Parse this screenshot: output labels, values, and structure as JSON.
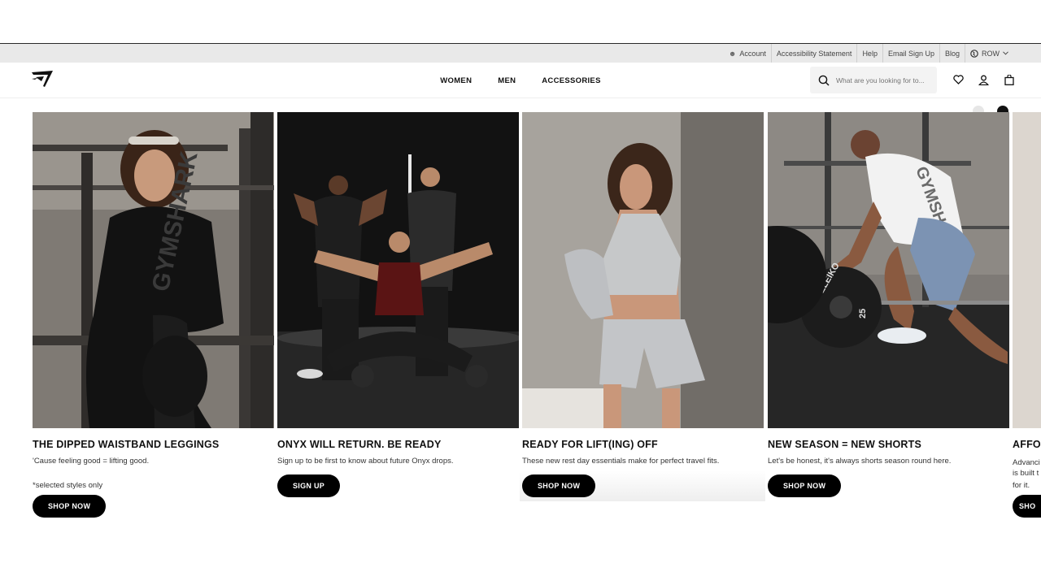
{
  "utility_bar": {
    "links": [
      "Account",
      "Accessibility Statement",
      "Help",
      "Email Sign Up",
      "Blog"
    ],
    "region": "ROW"
  },
  "header": {
    "nav": [
      "WOMEN",
      "MEN",
      "ACCESSORIES"
    ],
    "search_placeholder": "What are you looking for to..."
  },
  "colors": {
    "utility_bg": "#e9e9e9",
    "button_bg": "#000000",
    "button_text": "#ffffff"
  },
  "cards": [
    {
      "title": "THE DIPPED WAISTBAND LEGGINGS",
      "subtitle": "'Cause feeling good = lifting good.",
      "note": "*selected styles only",
      "button": "SHOP NOW"
    },
    {
      "title": "ONYX WILL RETURN. BE READY",
      "subtitle": "Sign up to be first to know about future Onyx drops.",
      "button": "SIGN UP"
    },
    {
      "title": "READY FOR LIFT(ING) OFF",
      "subtitle": "These new rest day essentials make for perfect travel fits.",
      "button": "SHOP NOW"
    },
    {
      "title": "NEW SEASON = NEW SHORTS",
      "subtitle": "Let's be honest, it's always shorts season round here.",
      "button": "SHOP NOW"
    },
    {
      "title": "AFFO",
      "subtitle_lines": [
        "Advanci",
        "is built t",
        "for it."
      ],
      "button": "SHO"
    }
  ],
  "image_text": {
    "hoodie_print": "GYMSHARK",
    "plate_brand": "ELEIKO",
    "plate_weight": "25"
  }
}
